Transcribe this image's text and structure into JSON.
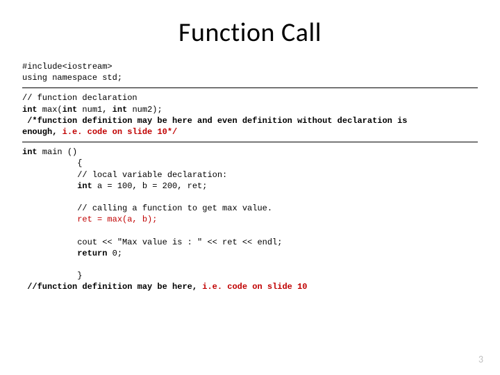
{
  "title": "Function Call",
  "code": {
    "inc1": "#include<iostream>",
    "inc2": "using namespace std;",
    "decl_comment": "// function declaration",
    "decl_int1": "int",
    "decl_mid1": " max(",
    "decl_int2": "int",
    "decl_mid2": " num1, ",
    "decl_int3": "int",
    "decl_end": " num2);",
    "block_comment_1a": " /*function definition may be here and even definition without declaration is",
    "block_comment_1b": "enough,",
    "block_comment_1c": " i.e. code on slide 10*/",
    "main_int": "int",
    "main_sig": " main ()",
    "lbrace": "           {",
    "local_decl_comment": "           // local variable declaration:",
    "local_int": "           int",
    "local_rest": " a = 100, b = 200, ret;",
    "call_comment": "           // calling a function to get max value.",
    "call_line": "           ret = max(a, b);",
    "cout_line": "           cout << \"Max value is : \" << ret << endl;",
    "return_kw": "           return",
    "return_rest": " 0;",
    "rbrace": "           }",
    "tail_comment_a": " //function definition may be here,",
    "tail_comment_b": " i.e. code on slide 10"
  },
  "page_number": "3"
}
